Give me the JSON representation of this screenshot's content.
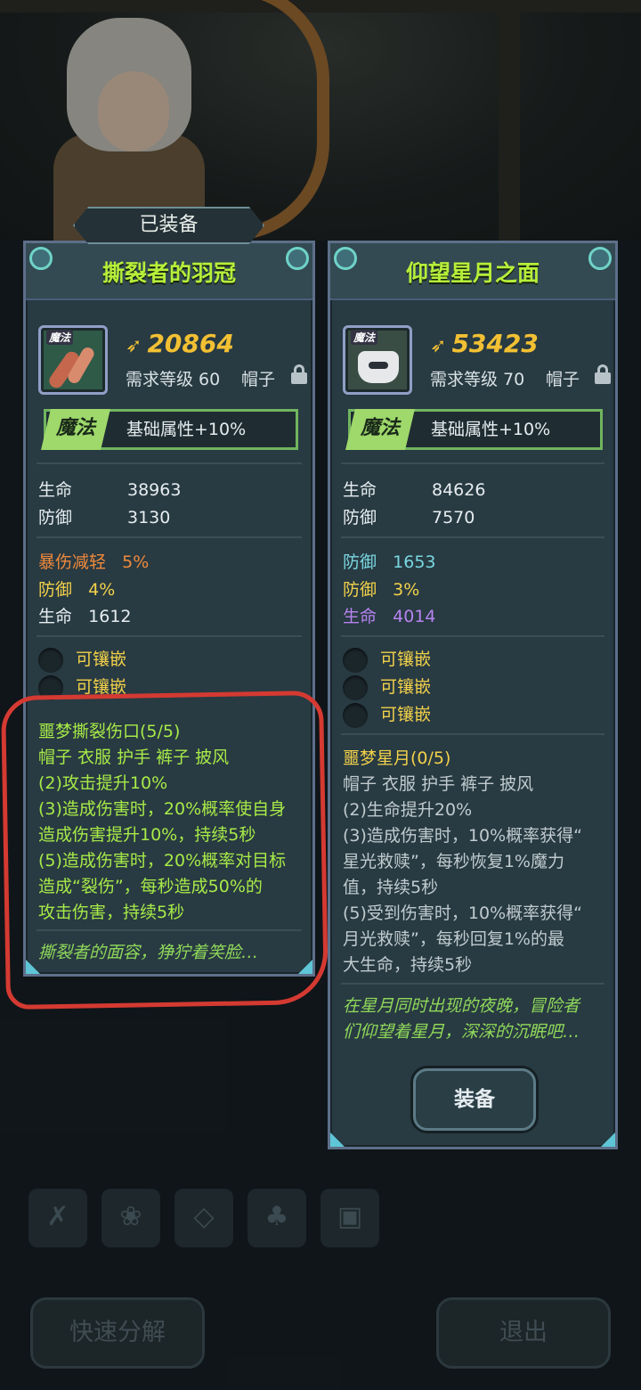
{
  "equipped_label": "已装备",
  "left_card": {
    "title": "撕裂者的羽冠",
    "icon_tag": "魔法",
    "power": "20864",
    "required_level": "需求等级 60",
    "slot": "帽子",
    "type_badge": "魔法",
    "type_bonus": "基础属性+10%",
    "base_stats": [
      {
        "label": "生命",
        "value": "38963"
      },
      {
        "label": "防御",
        "value": "3130"
      }
    ],
    "extra_stats": [
      {
        "label": "暴伤减轻",
        "value": "5%",
        "color": "#f08a3c"
      },
      {
        "label": "防御",
        "value": "4%",
        "color": "#f2d14a"
      },
      {
        "label": "生命",
        "value": "1612",
        "color": "#e6edf0"
      }
    ],
    "sockets": [
      "可镶嵌",
      "可镶嵌"
    ],
    "set_name": "噩梦撕裂伤口(5/5)",
    "set_slots": "帽子 衣服 护手 裤子 披风",
    "set_effects": [
      "(2)攻击提升10%",
      "(3)造成伤害时，20%概率使自身",
      "造成伤害提升10%，持续5秒",
      "(5)造成伤害时，20%概率对目标",
      "造成“裂伤”，每秒造成50%的",
      "攻击伤害，持续5秒"
    ],
    "lore": "撕裂者的面容，狰狞着笑脸…"
  },
  "right_card": {
    "title": "仰望星月之面",
    "icon_tag": "魔法",
    "power": "53423",
    "required_level": "需求等级 70",
    "slot": "帽子",
    "type_badge": "魔法",
    "type_bonus": "基础属性+10%",
    "base_stats": [
      {
        "label": "生命",
        "value": "84626"
      },
      {
        "label": "防御",
        "value": "7570"
      }
    ],
    "extra_stats": [
      {
        "label": "防御",
        "value": "1653",
        "color": "#7ad7e0"
      },
      {
        "label": "防御",
        "value": "3%",
        "color": "#f2d14a"
      },
      {
        "label": "生命",
        "value": "4014",
        "color": "#b684f0"
      }
    ],
    "sockets": [
      "可镶嵌",
      "可镶嵌",
      "可镶嵌"
    ],
    "set_name": "噩梦星月(0/5)",
    "set_slots": "帽子 衣服 护手 裤子 披风",
    "set_effects": [
      "(2)生命提升20%",
      "(3)造成伤害时，10%概率获得“",
      "星光救赎”，每秒恢复1%魔力",
      "值，持续5秒",
      "(5)受到伤害时，10%概率获得“",
      "月光救赎”，每秒回复1%的最",
      "大生命，持续5秒"
    ],
    "lore_lines": [
      "在星月同时出现的夜晚，冒险者",
      "们仰望着星月，深深的沉眠吧…"
    ],
    "equip_button": "装备"
  },
  "footer": {
    "quick_decompose": "快速分解",
    "exit": "退出"
  },
  "icons": {
    "power": "power-glyph",
    "lock": "lock-icon",
    "bottom_tabs": [
      "weapon-tab-icon",
      "paw-tab-icon",
      "gem-tab-icon",
      "leaf-tab-icon",
      "chest-tab-icon"
    ]
  },
  "colors": {
    "title_green": "#b6ef3a",
    "power_gold": "#f2c033",
    "set_active_green": "#a7ea48",
    "highlight_red": "#d43a32"
  }
}
